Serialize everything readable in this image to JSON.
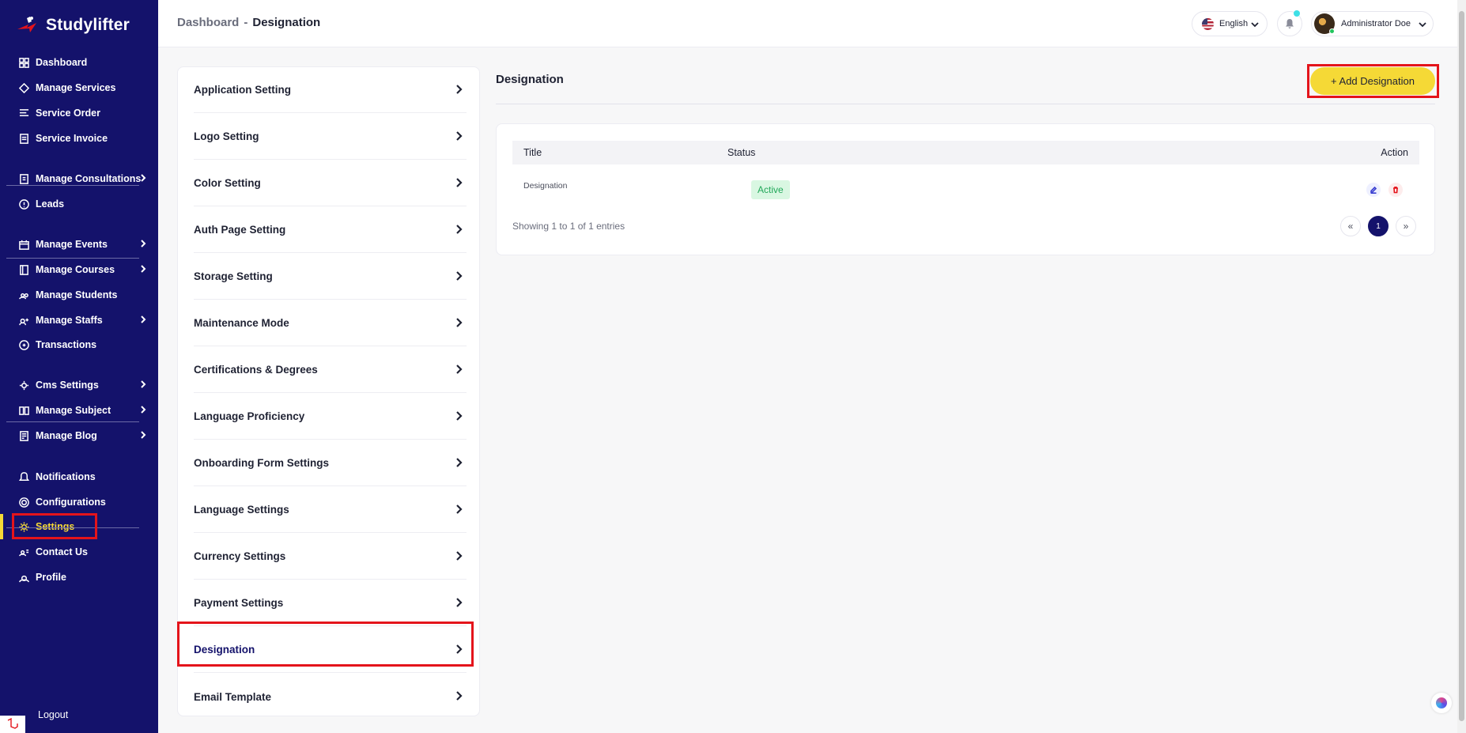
{
  "brand": {
    "name": "Studylifter"
  },
  "sidebar": {
    "items": [
      {
        "label": "Dashboard",
        "icon": "dashboard-icon"
      },
      {
        "label": "Manage Services",
        "icon": "services-icon"
      },
      {
        "label": "Service Order",
        "icon": "order-icon"
      },
      {
        "label": "Service Invoice",
        "icon": "invoice-icon"
      },
      {
        "label": "Manage Consultations",
        "icon": "consultation-icon"
      },
      {
        "label": "Leads",
        "icon": "leads-icon"
      },
      {
        "label": "Manage Events",
        "icon": "calendar-icon"
      },
      {
        "label": "Manage Courses",
        "icon": "courses-icon"
      },
      {
        "label": "Manage Students",
        "icon": "students-icon"
      },
      {
        "label": "Manage Staffs",
        "icon": "staff-icon"
      },
      {
        "label": "Transactions",
        "icon": "transactions-icon"
      },
      {
        "label": "Cms Settings",
        "icon": "cms-icon"
      },
      {
        "label": "Manage Subject",
        "icon": "book-icon"
      },
      {
        "label": "Manage Blog",
        "icon": "blog-icon"
      },
      {
        "label": "Notifications",
        "icon": "bell-icon"
      },
      {
        "label": "Configurations",
        "icon": "configuration-icon"
      },
      {
        "label": "Settings",
        "icon": "gear-icon"
      },
      {
        "label": "Contact Us",
        "icon": "contact-icon"
      },
      {
        "label": "Profile",
        "icon": "user-icon"
      }
    ],
    "logout_label": "Logout"
  },
  "header": {
    "breadcrumb_root": "Dashboard",
    "breadcrumb_sep": "-",
    "breadcrumb_current": "Designation",
    "language": "English",
    "user_name": "Administrator Doe"
  },
  "settings_menu": {
    "items": [
      "Application Setting",
      "Logo Setting",
      "Color Setting",
      "Auth Page Setting",
      "Storage Setting",
      "Maintenance Mode",
      "Certifications & Degrees",
      "Language Proficiency",
      "Onboarding Form Settings",
      "Language Settings",
      "Currency Settings",
      "Payment Settings",
      "Designation",
      "Email Template"
    ],
    "selected": "Designation"
  },
  "main": {
    "title": "Designation",
    "add_button": "+ Add Designation",
    "table": {
      "columns": [
        "Title",
        "Status",
        "Action"
      ],
      "rows": [
        {
          "title": "Designation",
          "status": "Active"
        }
      ]
    },
    "entries_text": "Showing 1 to 1 of 1 entries",
    "pagination": {
      "prev": "«",
      "current": "1",
      "next": "»"
    }
  },
  "colors": {
    "sidebar_bg": "#14126b",
    "accent_yellow": "#f5d936",
    "highlight_red": "#e4141b",
    "status_active": "#22a85a"
  }
}
